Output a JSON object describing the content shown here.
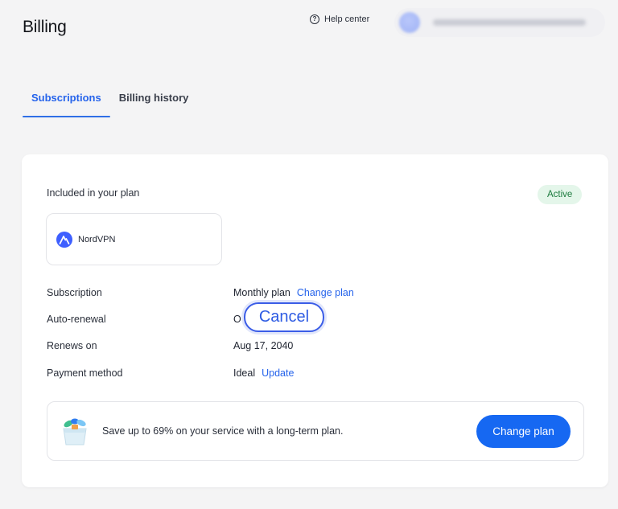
{
  "header": {
    "title": "Billing",
    "help_center_label": "Help center",
    "help_icon_glyph": "?"
  },
  "tabs": [
    {
      "label": "Subscriptions",
      "active": true
    },
    {
      "label": "Billing history",
      "active": false
    }
  ],
  "plan": {
    "included_label": "Included in your plan",
    "status_badge": "Active",
    "product_name": "NordVPN",
    "product_icon": "nordvpn-logo-icon"
  },
  "details": {
    "subscription": {
      "label": "Subscription",
      "value": "Monthly plan",
      "action": "Change plan"
    },
    "auto_renewal": {
      "label": "Auto-renewal",
      "value": "O",
      "action": "Cancel"
    },
    "renews_on": {
      "label": "Renews on",
      "value": "Aug 17, 2040"
    },
    "payment_method": {
      "label": "Payment method",
      "value": "Ideal",
      "action": "Update"
    }
  },
  "promo": {
    "icon": "gift-box-icon",
    "text": "Save up to 69% on your service with a long-term plan.",
    "button_label": "Change plan"
  },
  "colors": {
    "accent": "#2563eb",
    "primary_button": "#1668f2",
    "active_badge_bg": "#e4f6ea",
    "active_badge_text": "#1b7a3d",
    "highlight_ring": "#3b5de7"
  }
}
